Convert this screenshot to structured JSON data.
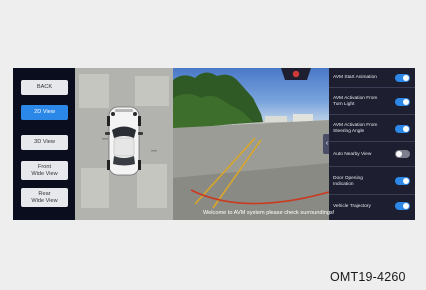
{
  "left_panel": {
    "buttons": [
      {
        "label": "BACK",
        "active": false
      },
      {
        "label": "2D View",
        "active": true
      },
      {
        "label": "3D View",
        "active": false
      },
      {
        "label": "Front\nWide View",
        "active": false
      },
      {
        "label": "Rear\nWide View",
        "active": false
      }
    ]
  },
  "settings": [
    {
      "label": "AVM Start Animation",
      "on": true
    },
    {
      "label": "AVM Activation From\nTurn Light",
      "on": true
    },
    {
      "label": "AVM Activation From\nSteering Angle",
      "on": true
    },
    {
      "label": "Auto Nearby View",
      "on": false
    },
    {
      "label": "Door Opening\nIndication",
      "on": true
    },
    {
      "label": "Vehicle Trajectory",
      "on": true
    }
  ],
  "message": "Welcome to AVM system please check surroundings!",
  "expand_icon": "chevron-left-icon",
  "figure_code": "OMT19-4260",
  "colors": {
    "accent": "#2b87e8",
    "panel": "#1d1f31",
    "screen": "#0a0d1e",
    "trajectory": "#c93a1e",
    "guide_lines": "#d8a62a"
  }
}
